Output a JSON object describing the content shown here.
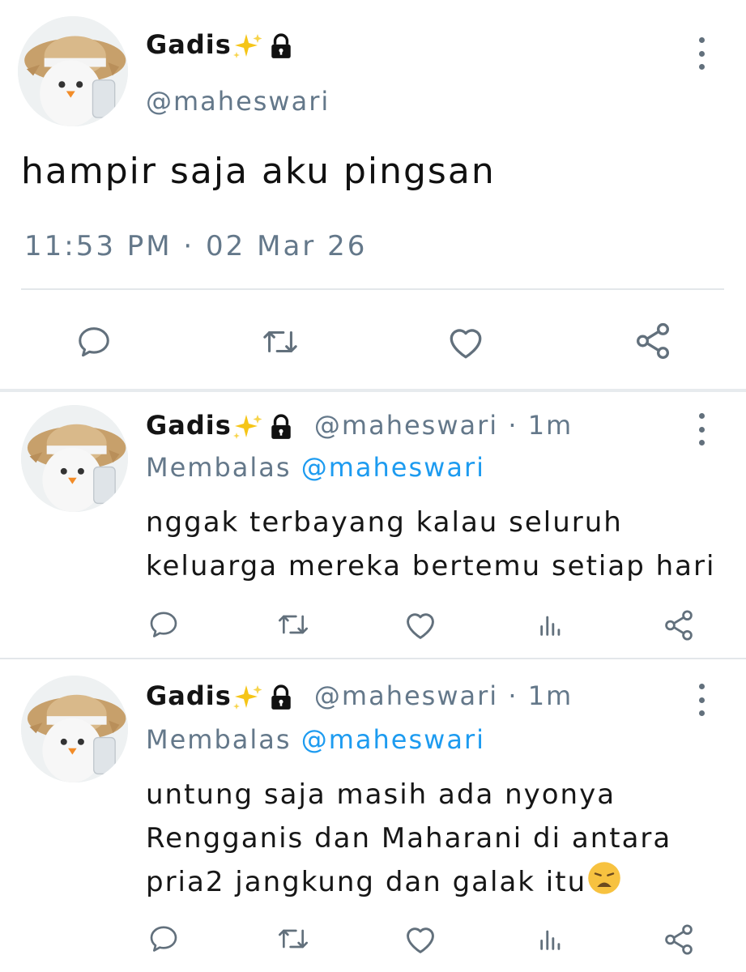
{
  "main_tweet": {
    "display_name": "Gadis",
    "handle": "@maheswari",
    "text": "hampir saja aku pingsan",
    "timestamp": "11:53 PM · 02 Mar 26"
  },
  "replies": [
    {
      "display_name": "Gadis",
      "handle_time": "@maheswari · 1m",
      "replying_prefix": "Membalas ",
      "replying_mention": "@maheswari",
      "lines": [
        "nggak terbayang kalau seluruh",
        "keluarga mereka bertemu setiap hari"
      ]
    },
    {
      "display_name": "Gadis",
      "handle_time": "@maheswari · 1m",
      "replying_prefix": "Membalas ",
      "replying_mention": "@maheswari",
      "lines": [
        "untung saja masih ada nyonya",
        "Rengganis dan Maharani di antara",
        "pria2  jangkung dan galak itu"
      ]
    }
  ],
  "icons": {
    "reply": "speech-bubble-icon",
    "retweet": "retweet-icon",
    "like": "heart-icon",
    "views": "bar-chart-icon",
    "share": "share-icon",
    "more": "more-vertical-icon",
    "lock": "lock-icon",
    "sparkles": "sparkles-icon"
  },
  "colors": {
    "icon_gray": "#62707c",
    "text_gray": "#64788a",
    "link_blue": "#1d9bf0",
    "sparkle_gold": "#f5c518"
  }
}
